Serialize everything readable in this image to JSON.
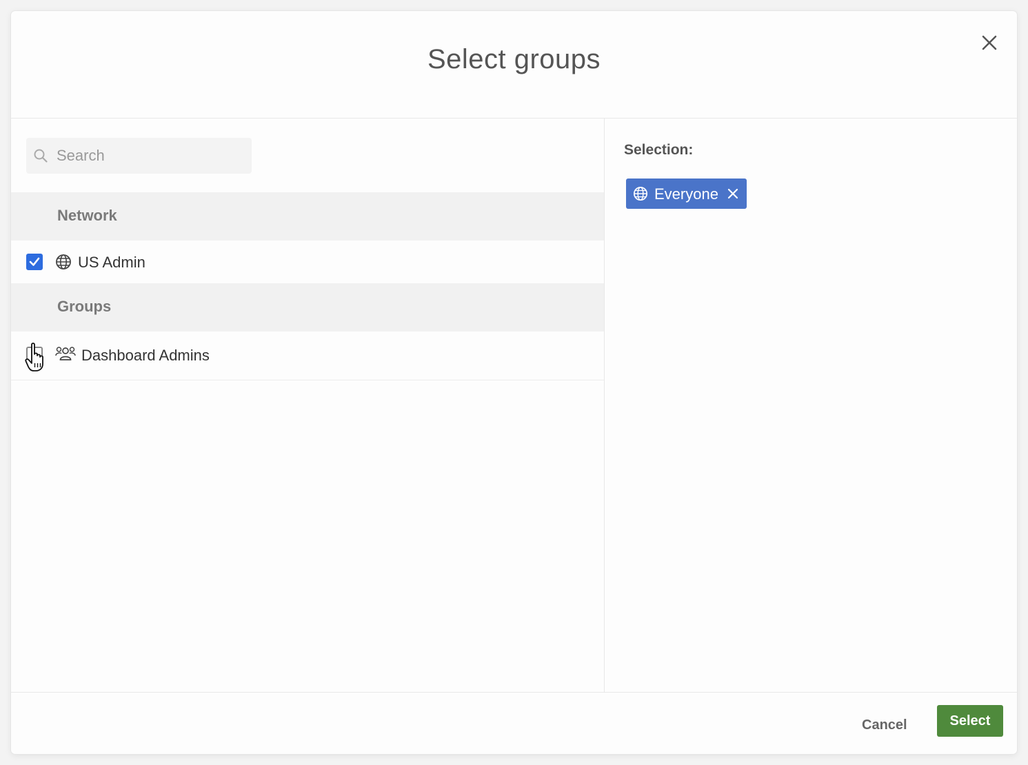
{
  "dialog": {
    "title": "Select groups",
    "close_icon": "close-icon"
  },
  "search": {
    "placeholder": "Search",
    "value": ""
  },
  "sections": [
    {
      "label": "Network",
      "items": [
        {
          "label": "US Admin",
          "icon": "globe-icon",
          "checked": true
        }
      ]
    },
    {
      "label": "Groups",
      "items": [
        {
          "label": "Dashboard Admins",
          "icon": "users-icon",
          "checked": false
        }
      ]
    }
  ],
  "selection": {
    "label": "Selection:",
    "chips": [
      {
        "label": "Everyone",
        "icon": "globe-icon",
        "remove_icon": "close-icon"
      }
    ]
  },
  "footer": {
    "cancel_label": "Cancel",
    "select_label": "Select"
  },
  "colors": {
    "accent_blue": "#2d6cdf",
    "chip_blue": "#4a74c9",
    "primary_green": "#4f8a3c"
  }
}
